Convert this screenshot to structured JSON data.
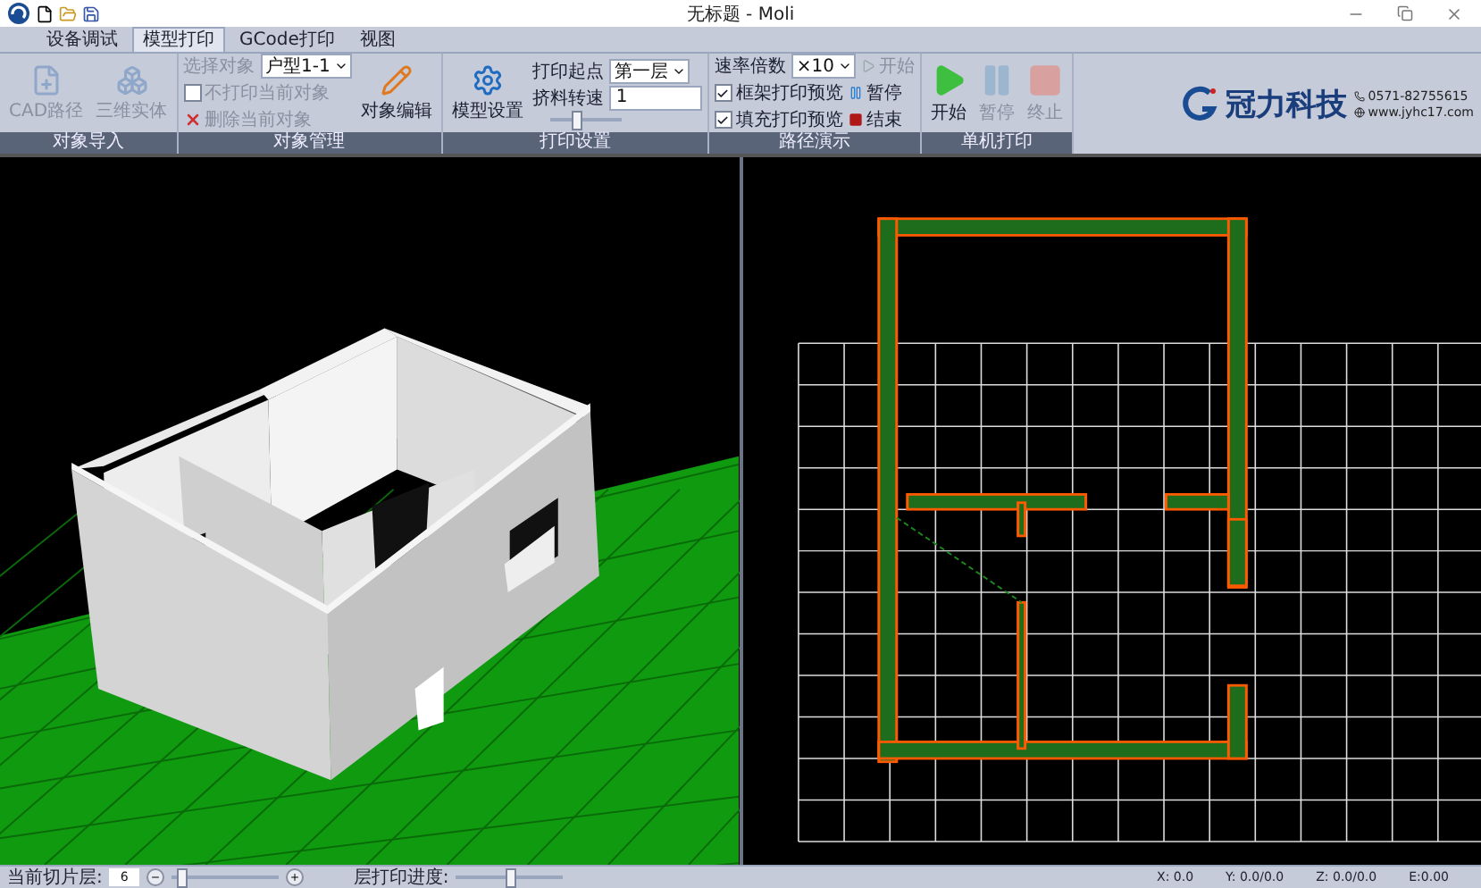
{
  "window": {
    "title": "无标题 - Moli"
  },
  "menu_tabs": [
    {
      "label": "设备调试",
      "selected": false
    },
    {
      "label": "模型打印",
      "selected": true
    },
    {
      "label": "GCode打印",
      "selected": false
    },
    {
      "label": "视图",
      "selected": false
    }
  ],
  "ribbon": {
    "import": {
      "label": "对象导入",
      "buttons": [
        {
          "label": "CAD路径",
          "disabled": true
        },
        {
          "label": "三维实体",
          "disabled": true
        }
      ]
    },
    "manage": {
      "label": "对象管理",
      "select_label": "选择对象",
      "select_value": "户型1-1",
      "skip_check": {
        "label": "不打印当前对象",
        "checked": false,
        "disabled": true
      },
      "delete": {
        "label": "删除当前对象",
        "disabled": true
      },
      "edit": {
        "label": "对象编辑",
        "disabled": false
      }
    },
    "settings": {
      "label": "打印设置",
      "model": {
        "label": "模型设置"
      },
      "start_label": "打印起点",
      "start_value": "第一层",
      "speed_label": "挤料转速",
      "speed_value": "1",
      "speed_slider": {
        "level": 0.35
      }
    },
    "preview": {
      "label": "路径演示",
      "rate_label": "速率倍数",
      "rate_value": "×10",
      "start": {
        "label": "开始",
        "disabled": true
      },
      "frame": {
        "label": "框架打印预览",
        "checked": true
      },
      "pause": {
        "label": "暂停",
        "disabled": false
      },
      "fill": {
        "label": "填充打印预览",
        "checked": true
      },
      "stop": {
        "label": "结束",
        "disabled": false
      }
    },
    "print": {
      "label": "单机打印",
      "buttons": [
        {
          "label": "开始",
          "kind": "play",
          "disabled": false
        },
        {
          "label": "暂停",
          "kind": "pause",
          "disabled": true
        },
        {
          "label": "终止",
          "kind": "stop",
          "disabled": true
        }
      ]
    }
  },
  "brand": {
    "name": "冠力科技",
    "phone": "0571-82755615",
    "website": "www.jyhc17.com"
  },
  "status_bar": {
    "layer_label": "当前切片层:",
    "layer_value": "6",
    "layer_slider": {
      "level": 0.05
    },
    "progress_label": "层打印进度:",
    "progress_slider": {
      "level": 0.5
    },
    "x": "X: 0.0",
    "y": "Y: 0.0/0.0",
    "z": "Z: 0.0/0.0",
    "e": "E:0.00"
  }
}
